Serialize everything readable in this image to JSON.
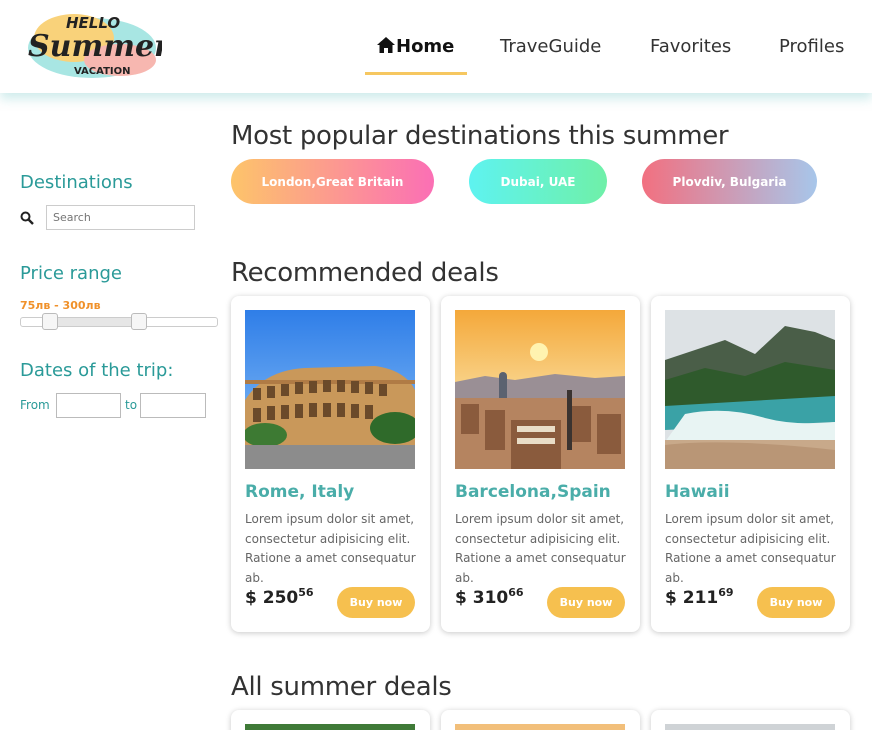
{
  "nav": {
    "items": [
      {
        "label": "Home",
        "icon": "home-icon"
      },
      {
        "label": "TraveGuide"
      },
      {
        "label": "Favorites"
      },
      {
        "label": "Profiles"
      }
    ],
    "active_index": 0
  },
  "logo": {
    "line1": "HELLO",
    "line2": "Summer",
    "line3": "VACATION"
  },
  "sidebar": {
    "destinations_title": "Destinations",
    "search_placeholder": "Search",
    "price_title": "Price range",
    "price_value": "75лв - 300лв",
    "price_min_fraction": 0.15,
    "price_max_fraction": 0.6,
    "dates_title": "Dates of the trip:",
    "from_label": "From",
    "to_label": "to"
  },
  "popular": {
    "title": "Most popular destinations this summer",
    "pills": [
      "London,Great Britain",
      "Dubai, UAE",
      "Plovdiv, Bulgaria"
    ]
  },
  "recommended": {
    "title": "Recommended deals",
    "cards": [
      {
        "title": "Rome, Italy",
        "desc": "Lorem ipsum dolor sit amet, consectetur adipisicing elit. Ratione a amet consequatur ab.",
        "currency": "$",
        "price_main": "250",
        "price_cents": "56",
        "buy_label": "Buy now"
      },
      {
        "title": "Barcelona,Spain",
        "desc": "Lorem ipsum dolor sit amet, consectetur adipisicing elit. Ratione a amet consequatur ab.",
        "currency": "$",
        "price_main": "310",
        "price_cents": "66",
        "buy_label": "Buy now"
      },
      {
        "title": "Hawaii",
        "desc": "Lorem ipsum dolor sit amet, consectetur adipisicing elit. Ratione a amet consequatur ab.",
        "currency": "$",
        "price_main": "211",
        "price_cents": "69",
        "buy_label": "Buy now"
      }
    ]
  },
  "all_deals": {
    "title": "All summer deals"
  },
  "colors": {
    "accent": "#2a9a98",
    "button": "#f6c04f",
    "price": "#f0912a",
    "card_title": "#4aada9"
  }
}
